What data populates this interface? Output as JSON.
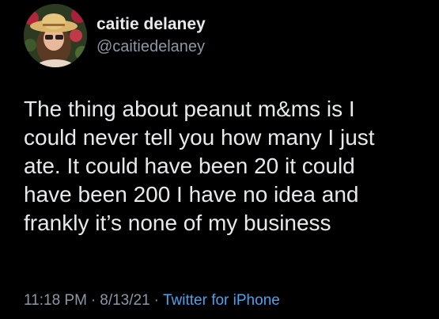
{
  "user": {
    "display_name": "caitie delaney",
    "handle": "@caitiedelaney",
    "avatar_icon": "profile-photo"
  },
  "tweet": {
    "lines": [
      "The thing about peanut m&ms is I",
      "could never tell you how many I just",
      "ate. It could have been 20 it could",
      "have been 200 I have no idea and",
      "frankly it’s none of my business"
    ]
  },
  "meta": {
    "time": "11:18 PM",
    "date": "8/13/21",
    "separator": "·",
    "source": "Twitter for iPhone"
  },
  "colors": {
    "background": "#000000",
    "primary_text": "#e7e9ea",
    "secondary_text": "#8b98a5",
    "link": "#4aa3ee"
  }
}
